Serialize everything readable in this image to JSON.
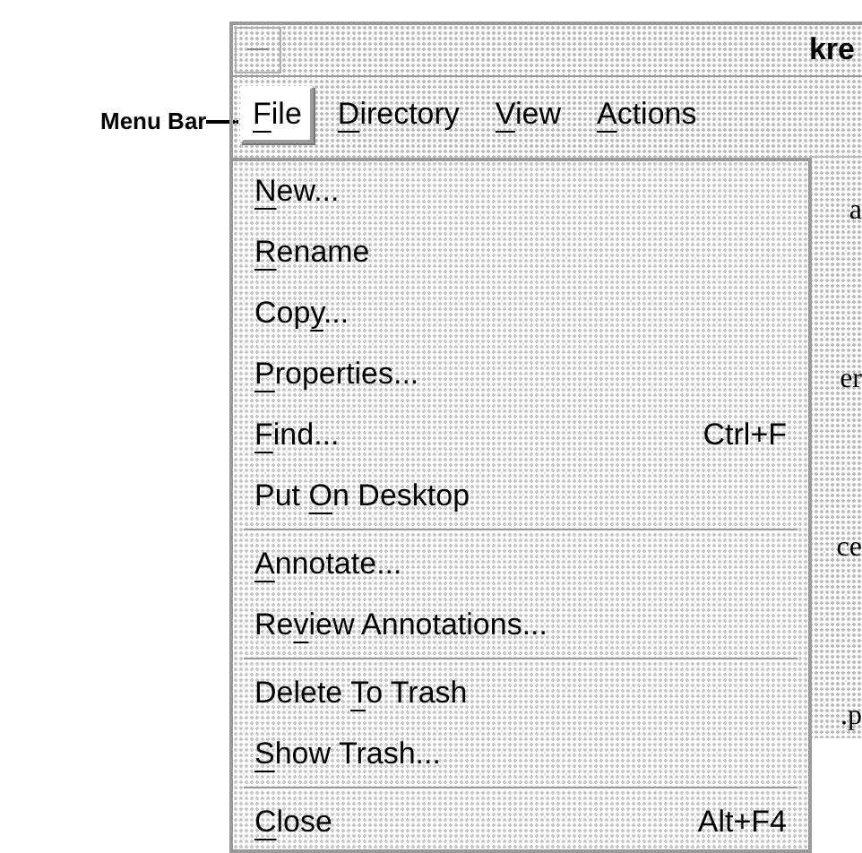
{
  "callout": {
    "label": "Menu Bar"
  },
  "window": {
    "title": "kre"
  },
  "menu_bar": [
    {
      "mnemonic": "F",
      "after": "ile",
      "selected": true
    },
    {
      "mnemonic": "D",
      "after": "irectory",
      "selected": false
    },
    {
      "mnemonic": "V",
      "after": "iew",
      "selected": false
    },
    {
      "mnemonic": "A",
      "after": "ctions",
      "selected": false
    }
  ],
  "background_fragments": [
    "a",
    "er",
    "ce",
    ".p"
  ],
  "menu": [
    {
      "kind": "item",
      "mnemonic": "N",
      "after": "ew..."
    },
    {
      "kind": "item",
      "mnemonic": "R",
      "after": "ename"
    },
    {
      "kind": "item",
      "before": "Cop",
      "mnemonic": "y",
      "after": "..."
    },
    {
      "kind": "item",
      "mnemonic": "P",
      "after": "roperties..."
    },
    {
      "kind": "item",
      "mnemonic": "F",
      "after": "ind...",
      "shortcut": "Ctrl+F"
    },
    {
      "kind": "item",
      "before": "Put ",
      "mnemonic": "O",
      "after": "n Desktop"
    },
    {
      "kind": "separator"
    },
    {
      "kind": "item",
      "mnemonic": "A",
      "after": "nnotate..."
    },
    {
      "kind": "item",
      "before": "Re",
      "mnemonic": "v",
      "after": "iew Annotations..."
    },
    {
      "kind": "separator"
    },
    {
      "kind": "item",
      "before": "Delete ",
      "mnemonic": "T",
      "after": "o Trash"
    },
    {
      "kind": "item",
      "mnemonic": "S",
      "after": "how Trash..."
    },
    {
      "kind": "separator"
    },
    {
      "kind": "item",
      "mnemonic": "C",
      "after": "lose",
      "shortcut": "Alt+F4"
    }
  ]
}
